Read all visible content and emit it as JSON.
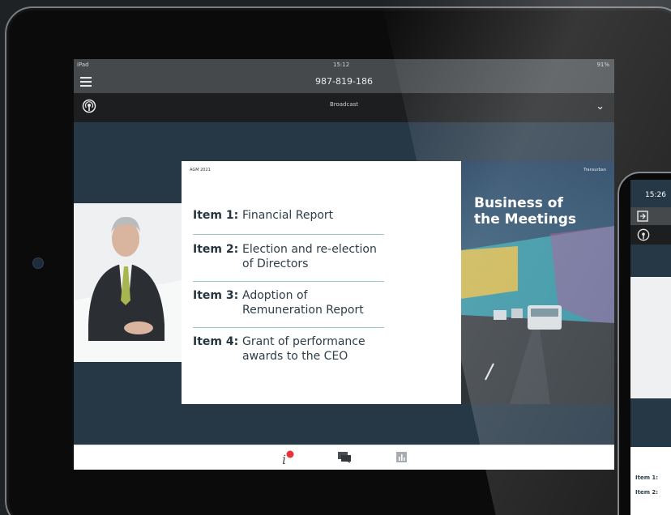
{
  "status_bar": {
    "left": "iPad",
    "time": "15:12",
    "right": "91%"
  },
  "nav": {
    "title": "987-819-186"
  },
  "broadcast": {
    "label": "Broadcast"
  },
  "slide": {
    "tag": "AGM 2021",
    "brand": "Transurban",
    "items": [
      {
        "num": "Item 1:",
        "line1": "Financial Report",
        "line2": ""
      },
      {
        "num": "Item 2:",
        "line1": "Election and re-election",
        "line2": "of Directors"
      },
      {
        "num": "Item 3:",
        "line1": "Adoption of",
        "line2": "Remuneration Report"
      },
      {
        "num": "Item 4:",
        "line1": "Grant of performance",
        "line2": "awards to the CEO"
      }
    ],
    "photo_title_1": "Business of",
    "photo_title_2": "the Meetings"
  },
  "phone": {
    "time": "15:26",
    "items": [
      "Item 1:",
      "Item 2:"
    ]
  },
  "icons": {
    "menu": "hamburger-icon",
    "broadcast": "broadcast-icon",
    "chevron": "chevron-down-icon",
    "info": "info-icon",
    "chat": "chat-icon",
    "poll": "poll-icon"
  },
  "colors": {
    "accent_red": "#e8323c",
    "screen_bg": "#263746",
    "navbar": "#45494c"
  }
}
